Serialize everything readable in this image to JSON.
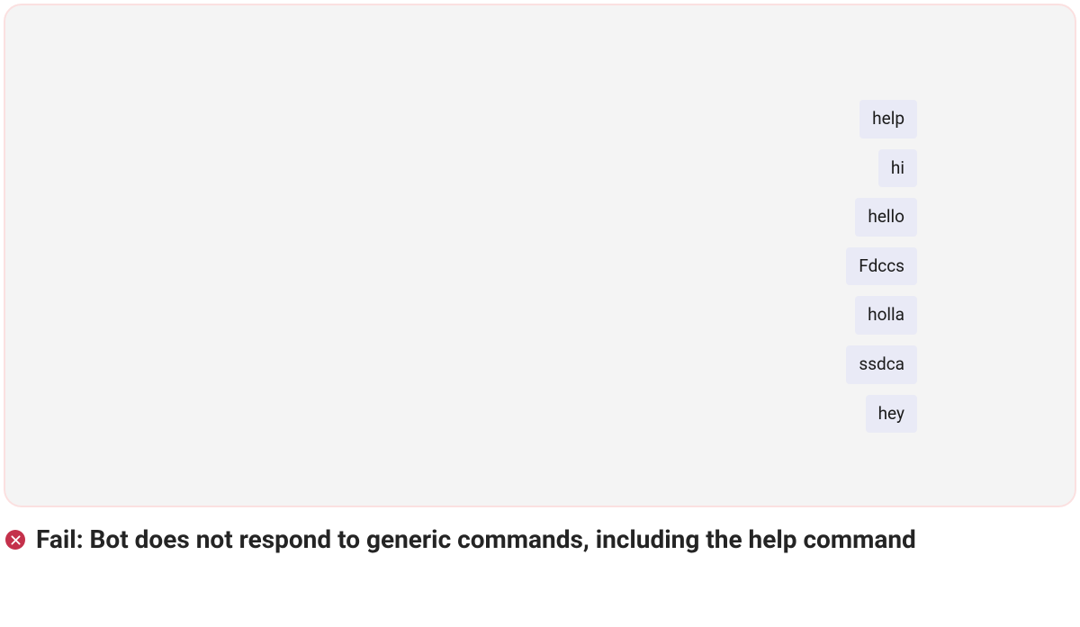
{
  "chat": {
    "messages": [
      {
        "text": "help"
      },
      {
        "text": "hi"
      },
      {
        "text": "hello"
      },
      {
        "text": "Fdccs"
      },
      {
        "text": "holla"
      },
      {
        "text": "ssdca"
      },
      {
        "text": "hey"
      }
    ]
  },
  "result": {
    "status": "fail",
    "message": "Fail: Bot does not respond to generic commands, including the help command"
  }
}
